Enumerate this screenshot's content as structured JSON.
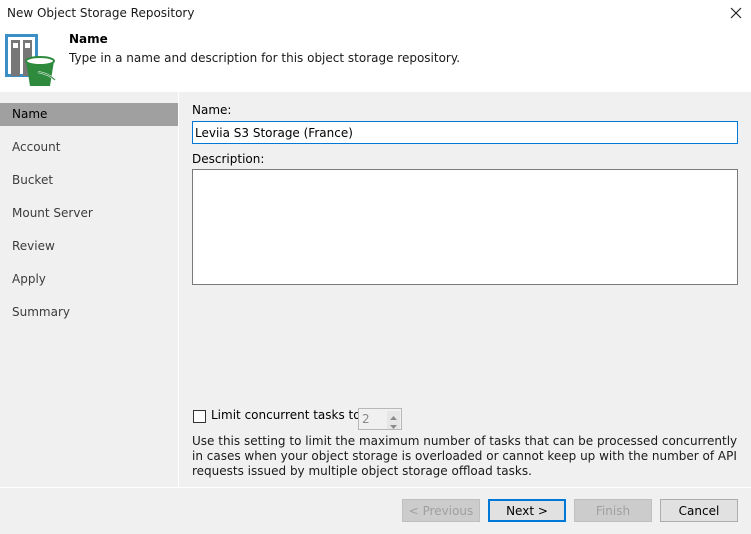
{
  "window": {
    "title": "New Object Storage Repository"
  },
  "header": {
    "step_title": "Name",
    "step_description": "Type in a name and description for this object storage repository.",
    "icon": "storage-bucket-icon"
  },
  "nav": {
    "items": [
      {
        "label": "Name",
        "active": true
      },
      {
        "label": "Account",
        "active": false
      },
      {
        "label": "Bucket",
        "active": false
      },
      {
        "label": "Mount Server",
        "active": false
      },
      {
        "label": "Review",
        "active": false
      },
      {
        "label": "Apply",
        "active": false
      },
      {
        "label": "Summary",
        "active": false
      }
    ]
  },
  "form": {
    "name_label": "Name:",
    "name_value": "Leviia S3 Storage (France)",
    "description_label": "Description:",
    "description_value": "",
    "limit_label": "Limit concurrent tasks to:",
    "limit_checked": false,
    "limit_value": "2",
    "help_text": "Use this setting to limit the maximum number of tasks that can be processed concurrently in cases when your object storage is overloaded or cannot keep up with the number of API requests issued by multiple object storage offload tasks."
  },
  "buttons": {
    "previous": "< Previous",
    "next": "Next >",
    "finish": "Finish",
    "cancel": "Cancel"
  },
  "colors": {
    "accent": "#0078d7",
    "bucket_green": "#2e8b3e",
    "nav_active": "#a0a0a0"
  }
}
